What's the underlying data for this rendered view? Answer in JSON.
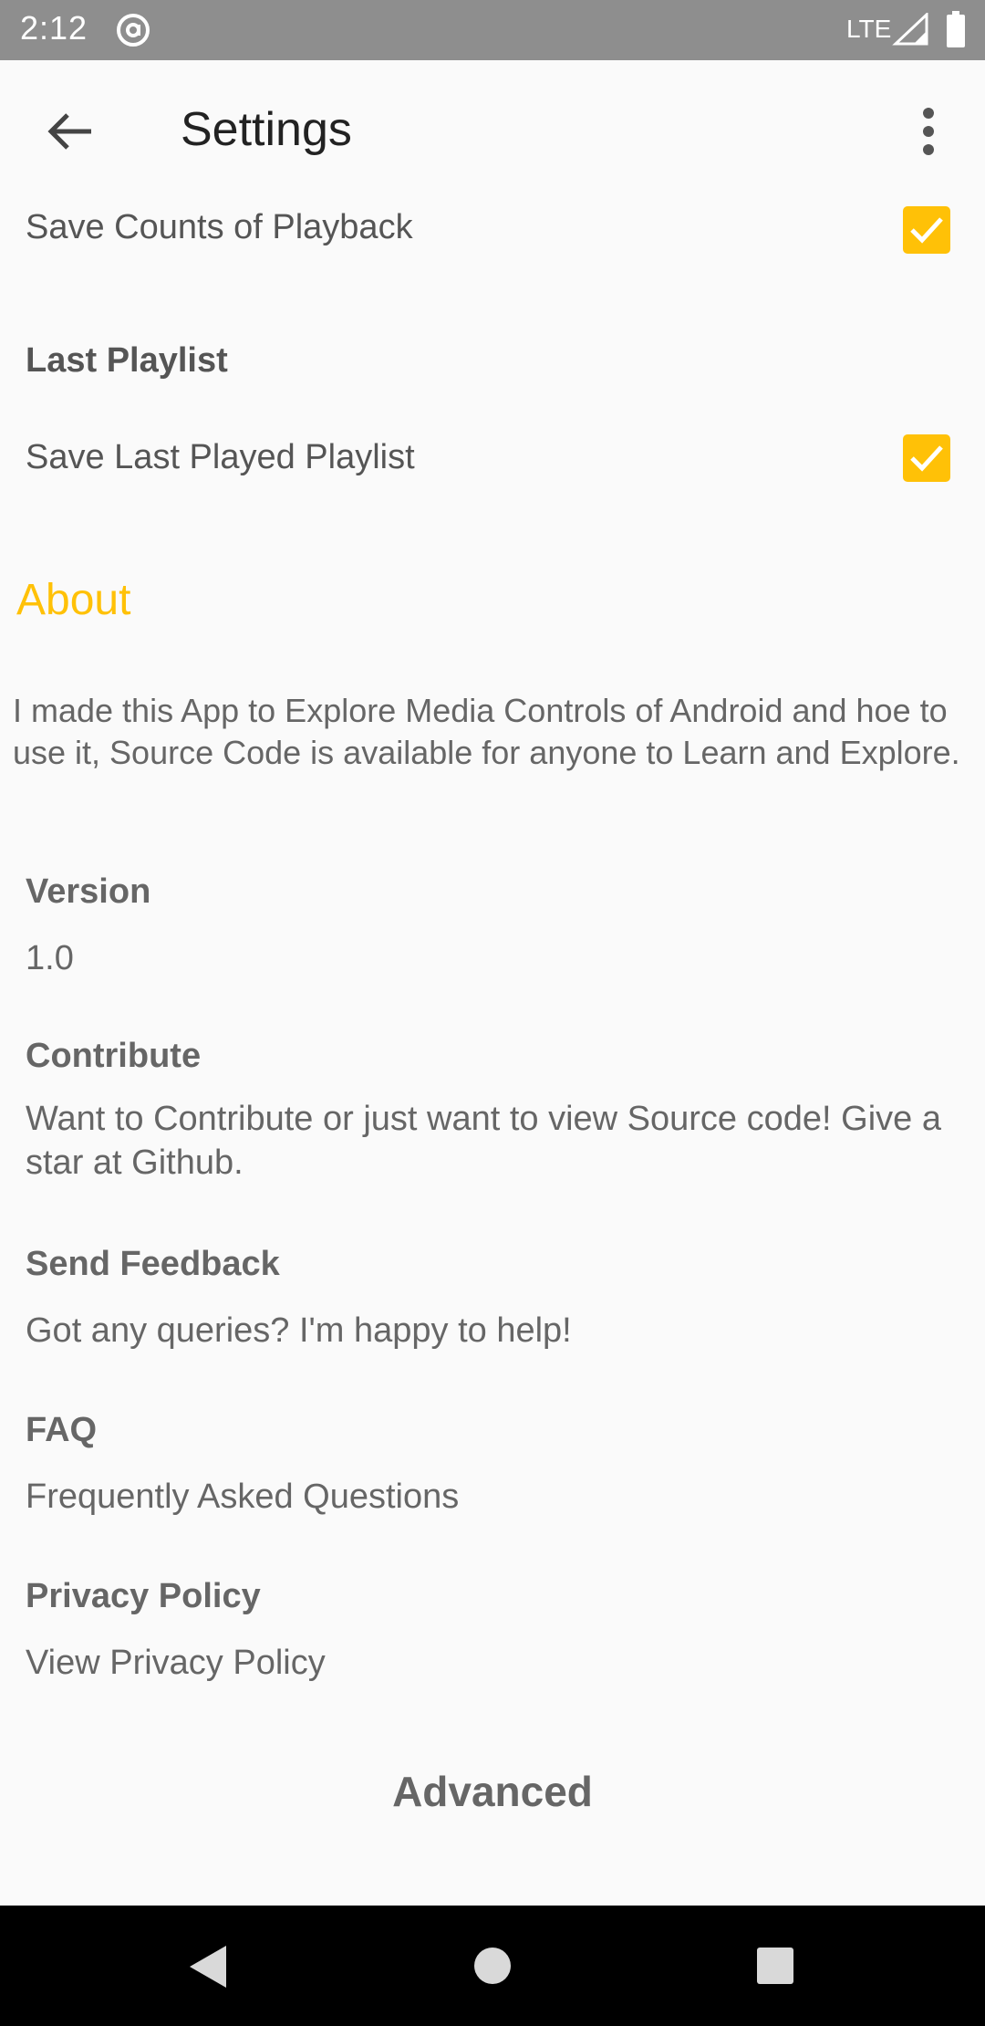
{
  "status_bar": {
    "time": "2:12",
    "network": "LTE",
    "icons": [
      "at-sign-icon",
      "signal-icon",
      "battery-icon"
    ]
  },
  "app_bar": {
    "title": "Settings",
    "back_icon": "arrow-back-icon",
    "menu_icon": "more-vert-icon"
  },
  "preferences": {
    "save_counts_label": "Save Counts of Playback",
    "save_counts_checked": true,
    "last_playlist_category": "Last Playlist",
    "save_last_playlist_label": "Save Last Played Playlist",
    "save_last_playlist_checked": true
  },
  "about": {
    "heading": "About",
    "description": "I made this App to Explore Media Controls of Android and hoe to use it, Source Code is available for anyone to Learn and Explore.",
    "items": [
      {
        "title": "Version",
        "summary": "1.0"
      },
      {
        "title": "Contribute",
        "summary": "Want to Contribute or just want to view Source code! Give a star at Github."
      },
      {
        "title": "Send Feedback",
        "summary": "Got any queries? I'm happy to help!"
      },
      {
        "title": "FAQ",
        "summary": "Frequently Asked Questions"
      },
      {
        "title": "Privacy Policy",
        "summary": "View Privacy Policy"
      }
    ]
  },
  "advanced": {
    "label": "Advanced"
  },
  "colors": {
    "accent": "#ffc107",
    "status_bar": "#8e8e8e",
    "nav_bar": "#000000",
    "background": "#fafafa"
  }
}
